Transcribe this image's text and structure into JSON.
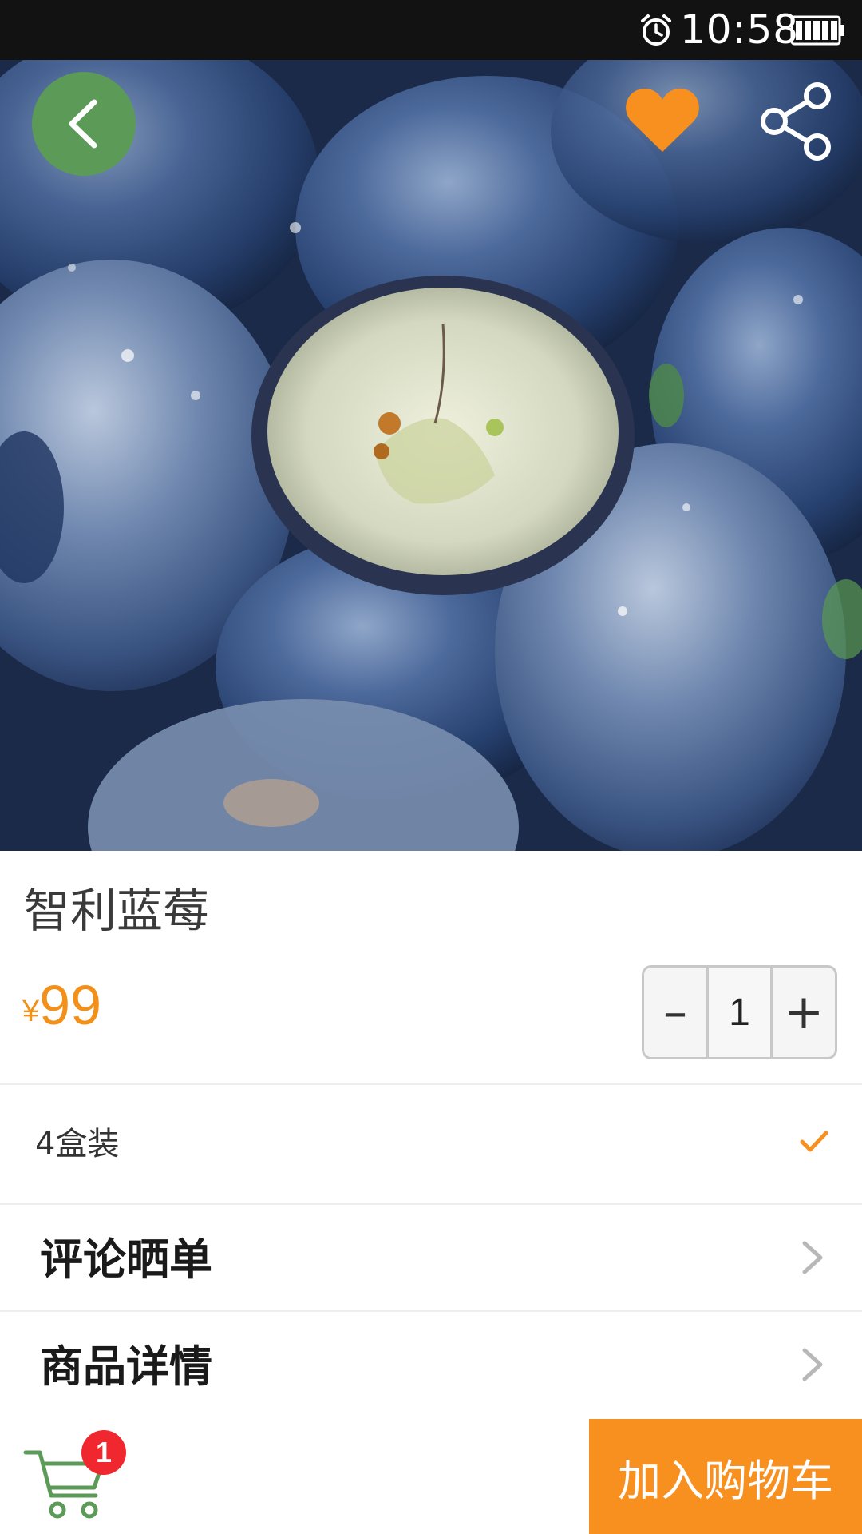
{
  "status_bar": {
    "time": "10:58",
    "icons": [
      "alarm-icon",
      "battery-icon"
    ]
  },
  "header": {
    "back_icon": "chevron-left-icon",
    "favorite_icon": "heart-icon",
    "share_icon": "share-icon"
  },
  "product": {
    "title": "智利蓝莓",
    "currency": "¥",
    "price": "99",
    "quantity": "1",
    "minus_label": "–",
    "plus_label": "+"
  },
  "spec": {
    "label": "4盒装",
    "selected": true
  },
  "sections": [
    {
      "label": "评论晒单"
    },
    {
      "label": "商品详情"
    }
  ],
  "footer": {
    "cart_count": "1",
    "add_to_cart_label": "加入购物车"
  },
  "colors": {
    "accent": "#f8901f",
    "price": "#f39019",
    "back_button": "#5c9a58",
    "badge": "#f1272f",
    "status_bar": "#121212"
  }
}
